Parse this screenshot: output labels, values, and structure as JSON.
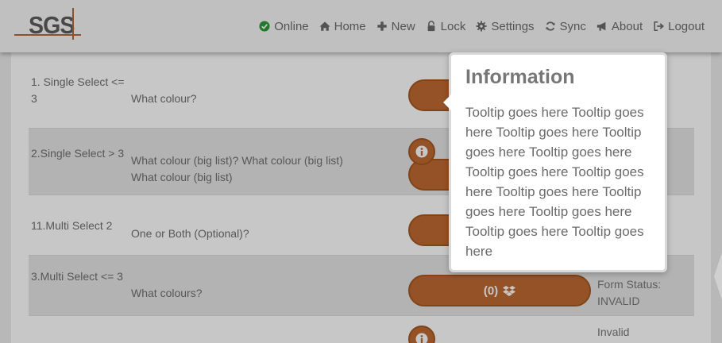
{
  "logo": {
    "text": "SGS"
  },
  "nav": [
    {
      "label": "Online",
      "icon": "check-circle-icon"
    },
    {
      "label": "Home",
      "icon": "home-icon"
    },
    {
      "label": "New",
      "icon": "plus-icon"
    },
    {
      "label": "Lock",
      "icon": "lock-icon"
    },
    {
      "label": "Settings",
      "icon": "gear-icon"
    },
    {
      "label": "Sync",
      "icon": "sync-icon"
    },
    {
      "label": "About",
      "icon": "bullhorn-icon"
    },
    {
      "label": "Logout",
      "icon": "logout-icon"
    }
  ],
  "rows": [
    {
      "label": "1. Single Select <= 3",
      "question": "What colour?"
    },
    {
      "label": "2.Single Select > 3",
      "question": "What colour (big list)? What colour (big list) What colour (big list)"
    },
    {
      "label": "11.Multi Select 2",
      "question": "One or Both (Optional)?"
    },
    {
      "label": "3.Multi Select <= 3",
      "question": "What colours?",
      "button_label": "(0)",
      "status_label": "Form Status:",
      "status_value": "INVALID"
    },
    {
      "status_value": "Invalid"
    }
  ],
  "popover": {
    "title": "Information",
    "body": "Tooltip goes here Tooltip goes here Tooltip goes here Tooltip goes here Tooltip goes here Tooltip goes here Tooltip goes here Tooltip goes here Tooltip goes here Tooltip goes here Tooltip goes here Tooltip goes here"
  },
  "colors": {
    "accent": "#bf6a33",
    "accent_border": "#a6561f",
    "logo_line": "#b3673a",
    "header_bg": "#f7f7f7",
    "online_check": "#2e9a3c"
  }
}
